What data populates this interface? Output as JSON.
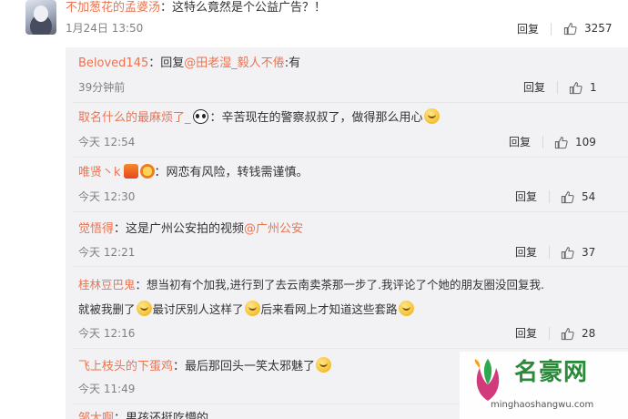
{
  "top_comment": {
    "username": "不加葱花的孟婆汤",
    "text": "：这特么竟然是个公益广告？！",
    "time": "1月24日 13:50",
    "reply_label": "回复",
    "likes": "3257"
  },
  "replies": [
    {
      "username": "Beloved145",
      "prefix": "：回复",
      "mention": "@田老湿_毅人不倦",
      "text": ":有",
      "time": "39分钟前",
      "reply_label": "回复",
      "likes": "1"
    },
    {
      "username": "取名什么的最麻烦了_",
      "emoji_before": "panda",
      "text": "：辛苦现在的警察叔叔了，做得那么用心",
      "emoji_after": "laugh",
      "time": "今天 12:54",
      "reply_label": "回复",
      "likes": "109"
    },
    {
      "username": "唯贤丶k",
      "badges": true,
      "text": "：网恋有风险，转钱需谨慎。",
      "time": "今天 12:30",
      "reply_label": "回复",
      "likes": "54"
    },
    {
      "username": "觉悟得",
      "text": "：这是广州公安拍的视频",
      "mention": "@广州公安",
      "time": "今天 12:21",
      "reply_label": "回复",
      "likes": "37"
    },
    {
      "username": "桂林豆巴鬼",
      "text": "：想当初有个加我,进行到了去云南卖茶那一步了.我评论了个她的朋友圈没回复我.",
      "text2a": "就被我删了",
      "text2b": "最讨厌别人这样了",
      "text2c": "后来看网上才知道这些套路",
      "time": "今天 12:16",
      "reply_label": "回复",
      "likes": "28"
    },
    {
      "username": "飞上枝头的下蛋鸡",
      "text": "：最后那回头一笑太邪魅了",
      "time": "今天 11:49"
    },
    {
      "partial_username": "邹大啊",
      "partial_text": "：男孩还挺吃懵的"
    }
  ],
  "watermark": {
    "brand": "名豪网",
    "url": "minghaoshangwu.com"
  },
  "colors": {
    "username": "#eb7350",
    "reply_bg": "#f2f2f5",
    "text": "#333333",
    "meta": "#808080",
    "watermark": "#2a8a3a"
  },
  "icons": [
    "avatar",
    "thumbs-up-icon",
    "panda-emoji",
    "laugh-emoji",
    "cry-laugh-emoji",
    "shy-emoji",
    "verified-badge-icon"
  ]
}
